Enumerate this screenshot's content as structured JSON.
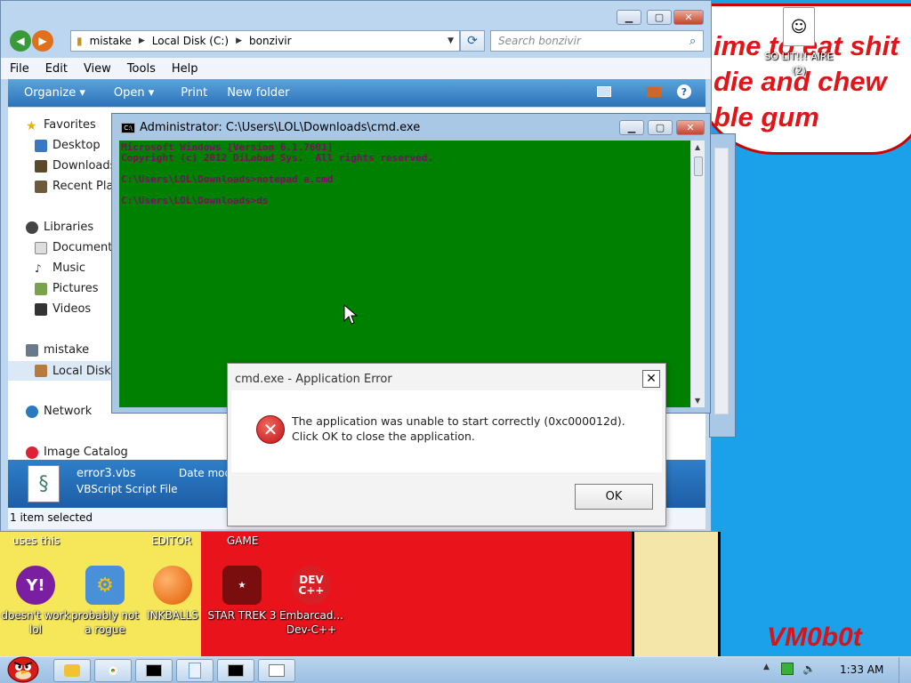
{
  "wallpaper": {
    "line1": "ime to eat shit",
    "line2": "die and chew",
    "line3": "ble gum",
    "signature": "VM0b0t",
    "label_uses_this": "uses this",
    "label_editor": "EDITOR",
    "label_game": "GAME"
  },
  "desktop_icons": [
    {
      "label": "SO LIT!!! AIRE (2)"
    },
    {
      "label": "doesn't work lol"
    },
    {
      "label": "probably not a rogue"
    },
    {
      "label": "INKBALLS"
    },
    {
      "label": "STAR TREK 3"
    },
    {
      "label": "Embarcad... Dev-C++"
    }
  ],
  "explorer": {
    "breadcrumb": [
      "mistake",
      "Local Disk (C:)",
      "bonzivir"
    ],
    "search_placeholder": "Search bonzivir",
    "menu": [
      "File",
      "Edit",
      "View",
      "Tools",
      "Help"
    ],
    "commands": [
      "Organize ▾",
      "Open ▾",
      "Print",
      "New folder"
    ],
    "nav": {
      "favorites": "Favorites",
      "desktop": "Desktop",
      "downloads": "Downloads",
      "recent": "Recent Plac",
      "libraries": "Libraries",
      "documents": "Documents",
      "music": "Music",
      "pictures": "Pictures",
      "videos": "Videos",
      "mistake": "mistake",
      "localdisk": "Local Disk (",
      "network": "Network",
      "imagecatalog": "Image Catalog"
    },
    "details": {
      "filename": "error3.vbs",
      "filetype": "VBScript Script File",
      "date_label": "Date mod"
    },
    "status": "1 item selected"
  },
  "cmd": {
    "title": "Administrator: C:\\Users\\LOL\\Downloads\\cmd.exe",
    "lines": [
      "Microsoft Windows [Version 6.1.7601]",
      "Copyright (c) 2012 DiLabad Sys.  All rights reserved.",
      "",
      "C:\\Users\\LOL\\Downloads>notepad a.cmd",
      "",
      "C:\\Users\\LOL\\Downloads>ds"
    ]
  },
  "dialog": {
    "title": "cmd.exe - Application Error",
    "message": "The application was unable to start correctly (0xc000012d). Click OK to close the application.",
    "ok": "OK"
  },
  "taskbar": {
    "clock": "1:33 AM"
  }
}
